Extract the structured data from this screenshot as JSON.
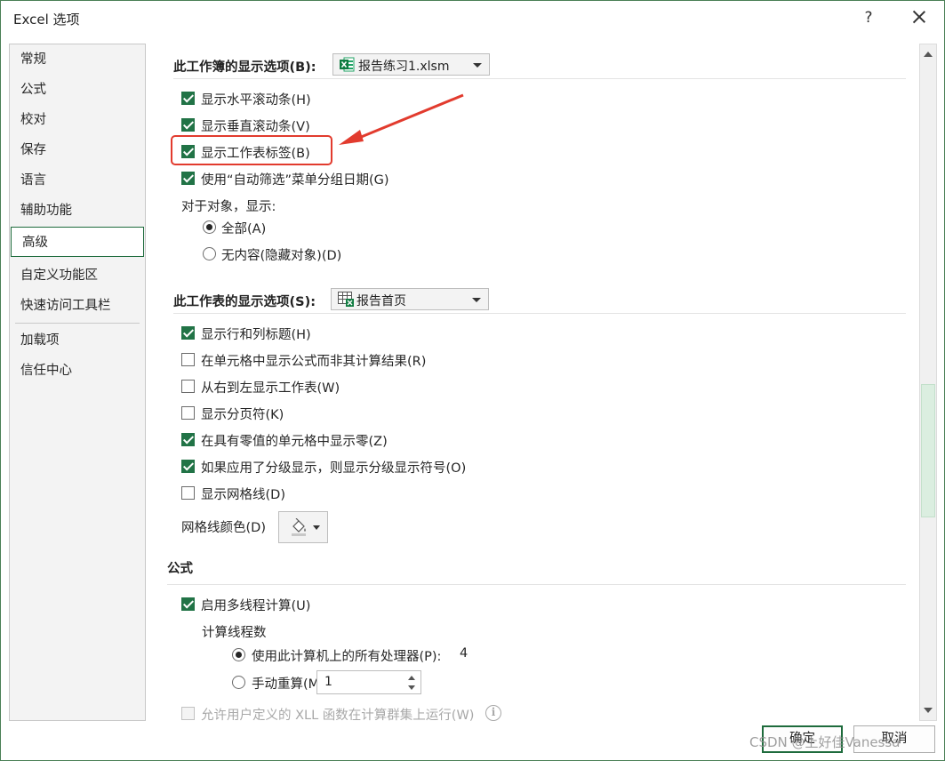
{
  "window": {
    "title": "Excel 选项",
    "help_label": "?",
    "close_icon": "close-icon"
  },
  "nav": {
    "items": [
      {
        "label": "常规"
      },
      {
        "label": "公式"
      },
      {
        "label": "校对"
      },
      {
        "label": "保存"
      },
      {
        "label": "语言"
      },
      {
        "label": "辅助功能"
      },
      {
        "label": "高级",
        "selected": true
      },
      {
        "label": "自定义功能区"
      },
      {
        "label": "快速访问工具栏"
      },
      {
        "label": "加载项"
      },
      {
        "label": "信任中心"
      }
    ]
  },
  "workbook_section": {
    "header": "此工作簿的显示选项(B):",
    "dropdown_value": "报告练习1.xlsm",
    "dropdown_icon": "excel-file-icon",
    "options": [
      {
        "label": "显示水平滚动条(H)",
        "checked": true
      },
      {
        "label": "显示垂直滚动条(V)",
        "checked": true
      },
      {
        "label": "显示工作表标签(B)",
        "checked": true
      },
      {
        "label": "使用“自动筛选”菜单分组日期(G)",
        "checked": true
      }
    ],
    "objects_label": "对于对象，显示:",
    "objects_radios": [
      {
        "label": "全部(A)",
        "checked": true
      },
      {
        "label": "无内容(隐藏对象)(D)",
        "checked": false
      }
    ]
  },
  "worksheet_section": {
    "header": "此工作表的显示选项(S):",
    "dropdown_value": "报告首页",
    "dropdown_icon": "sheet-icon",
    "options": [
      {
        "label": "显示行和列标题(H)",
        "checked": true
      },
      {
        "label": "在单元格中显示公式而非其计算结果(R)",
        "checked": false
      },
      {
        "label": "从右到左显示工作表(W)",
        "checked": false
      },
      {
        "label": "显示分页符(K)",
        "checked": false
      },
      {
        "label": "在具有零值的单元格中显示零(Z)",
        "checked": true
      },
      {
        "label": "如果应用了分级显示，则显示分级显示符号(O)",
        "checked": true
      },
      {
        "label": "显示网格线(D)",
        "checked": false
      }
    ],
    "gridline_color_label": "网格线颜色(D)",
    "gridline_color_icon": "paint-bucket-icon"
  },
  "formula_section": {
    "header": "公式",
    "multithread": {
      "label": "启用多线程计算(U)",
      "checked": true
    },
    "threads_label": "计算线程数",
    "use_all": {
      "label": "使用此计算机上的所有处理器(P):",
      "value": "4",
      "checked": true
    },
    "manual": {
      "label": "手动重算(M)",
      "value": "1",
      "checked": false
    },
    "xll": {
      "label": "允许用户定义的 XLL 函数在计算群集上运行(W)",
      "checked": false,
      "disabled": true
    },
    "info_icon_text": "i"
  },
  "footer": {
    "ok_label": "确定",
    "cancel_label": "取消"
  },
  "watermark": "CSDN @上好佳Vanessa",
  "colors": {
    "accent": "#217346",
    "annotation": "#e23b2e"
  }
}
